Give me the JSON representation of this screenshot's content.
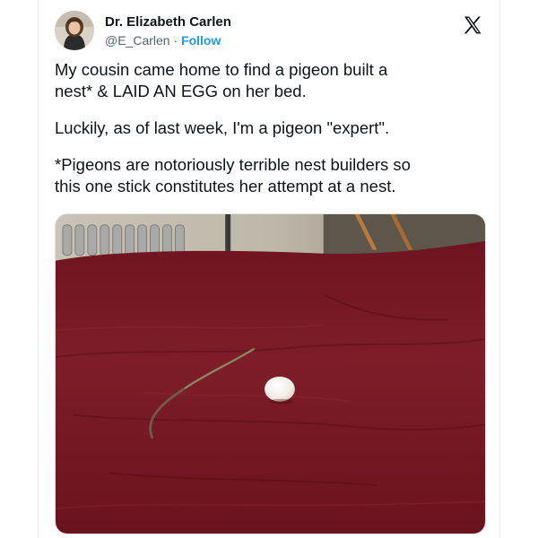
{
  "author": {
    "display_name": "Dr. Elizabeth Carlen",
    "handle": "@E_Carlen",
    "separator": " · ",
    "follow_label": "Follow"
  },
  "tweet": {
    "paragraphs": [
      "My cousin came home to find a pigeon built a\nnest* & LAID AN EGG on her bed.",
      "Luckily, as of last week, I'm a pigeon \"expert\".",
      "*Pigeons are notoriously terrible nest builders so\nthis one stick constitutes her attempt at a nest."
    ]
  },
  "icons": {
    "platform_logo": "x-logo-icon",
    "avatar": "avatar-photo"
  },
  "colors": {
    "link_blue": "#1d9bf0",
    "text": "#0f1419",
    "muted": "#536471",
    "bedspread": "#7a1c26"
  }
}
